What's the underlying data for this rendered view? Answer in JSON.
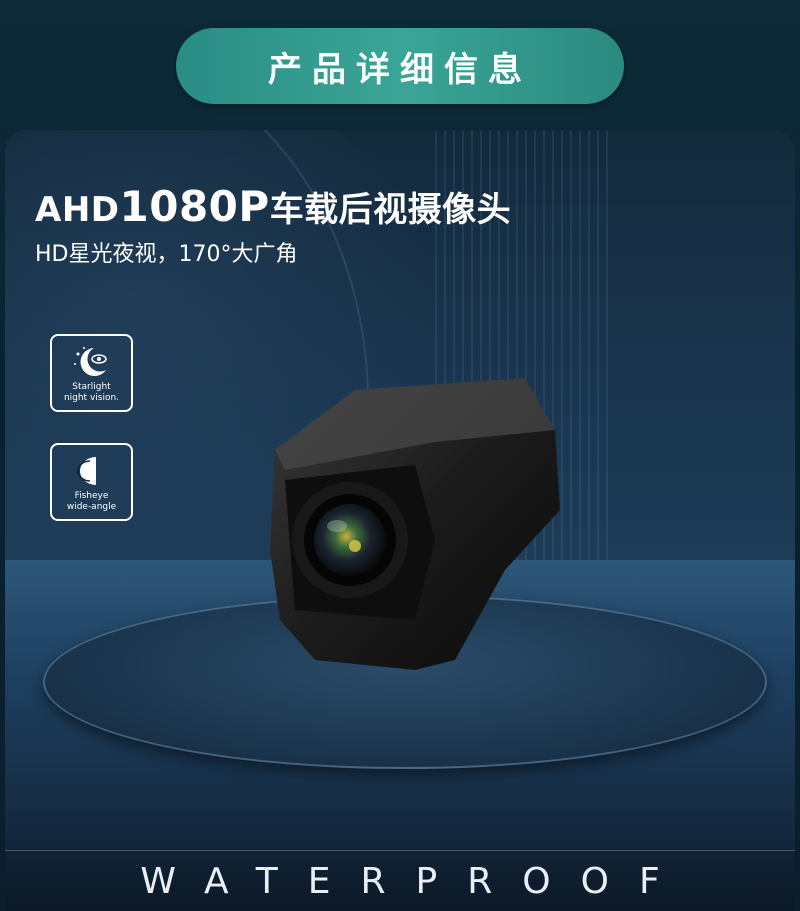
{
  "header": {
    "label": "产品详细信息"
  },
  "product": {
    "title_prefix": "AHD",
    "title_number": "1080P",
    "title_suffix": "车载后视摄像头",
    "subtitle": "HD星光夜视，170°大广角"
  },
  "features": [
    {
      "icon": "moon-eye-icon",
      "line1": "Starlight",
      "line2": "night vision."
    },
    {
      "icon": "fisheye-icon",
      "line1": "Fisheye",
      "line2": "wide-angle"
    }
  ],
  "footer": {
    "label": "WATERPROOF"
  },
  "colors": {
    "pill": "#3aa596",
    "background": "#0d2c38",
    "panel": "#1a3650"
  }
}
